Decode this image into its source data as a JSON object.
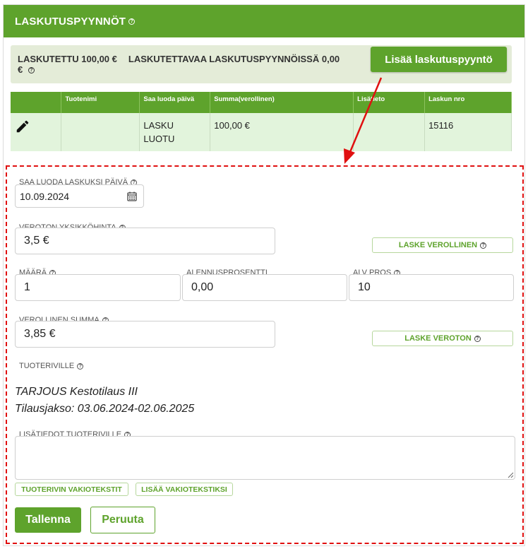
{
  "header": {
    "title": "LASKUTUSPYYNNÖT",
    "help_icon": "question-circle-icon"
  },
  "summary": {
    "invoiced": "LASKUTETTU 100,00 €",
    "pending_a": "LASKUTETTAVAA LASKUTUSPYYNNÖISSÄ 0,00",
    "pending_b": "€"
  },
  "add_button": {
    "label": "Lisää laskutuspyyntö"
  },
  "table": {
    "headers": [
      "",
      "Tuotenimi",
      "Saa luoda päivä",
      "Summa(verollinen)",
      "Lisätieto",
      "Laskun nro"
    ],
    "row": {
      "edit_icon": "pencil-icon",
      "product": "",
      "date_line1": "LASKU",
      "date_line2": "LUOTU",
      "sum": "100,00 €",
      "info": "",
      "invoice_no": "15116"
    }
  },
  "form": {
    "date": {
      "label": "SAA LUODA LASKUKSI PÄIVÄ",
      "value": "10.09.2024",
      "icon": "calendar-icon"
    },
    "unit_price": {
      "label": "VEROTON YKSIKKÖHINTA",
      "value": "3,5 €"
    },
    "calc_taxed_button": "LASKE VEROLLINEN",
    "quantity": {
      "label": "MÄÄRÄ",
      "value": "1"
    },
    "discount": {
      "label": "ALENNUSPROSENTTI",
      "value": "0,00"
    },
    "vat": {
      "label": "ALV PROS",
      "value": "10"
    },
    "taxed_sum": {
      "label": "VEROLLINEN SUMMA",
      "value": "3,85 €"
    },
    "calc_untaxed_button": "LASKE VEROTON",
    "product_row": {
      "label": "TUOTERIVILLE",
      "line1": "TARJOUS Kestotilaus III",
      "line2": "Tilausjakso: 03.06.2024-02.06.2025"
    },
    "extra_info": {
      "label": "LISÄTIEDOT TUOTERIVILLE",
      "value": ""
    },
    "standard_texts_button": "TUOTERIVIN VAKIOTEKSTIT",
    "add_standard_text_button": "LISÄÄ VAKIOTEKSTIKSI",
    "save_button": "Tallenna",
    "cancel_button": "Peruuta"
  },
  "colors": {
    "brand_green": "#5ea32c",
    "annotation_red": "#e01010",
    "row_bg": "#e2f4dc"
  }
}
